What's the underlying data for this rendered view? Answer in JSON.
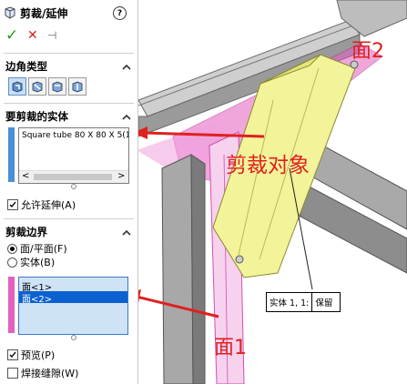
{
  "panel": {
    "title": "剪裁/延伸",
    "help_glyph": "?",
    "confirm_glyph": "✓",
    "cancel_glyph": "✕",
    "pin_glyph": "⊣",
    "corner_type": {
      "label": "边角类型",
      "icons": [
        "end-trim-icon",
        "end-miter-icon",
        "end-butt1-icon",
        "end-butt2-icon"
      ]
    },
    "bodies_to_trim": {
      "label": "要剪裁的实体",
      "items": [
        "Square tube 80 X 80 X 5(1"
      ],
      "scroll_left": "<",
      "scroll_right": ">",
      "allow_extend": {
        "label": "允许延伸(A)",
        "checked": true
      }
    },
    "trim_boundary": {
      "label": "剪裁边界",
      "options": [
        {
          "label": "面/平面(F)",
          "selected": true
        },
        {
          "label": "实体(B)",
          "selected": false
        }
      ],
      "faces": [
        "面<1>",
        "面<2>"
      ],
      "selected_face": "面<2>"
    },
    "preview": {
      "label": "预览(P)",
      "checked": true
    },
    "weld_gap": {
      "label": "焊接缝隙(W)",
      "checked": false
    }
  },
  "viewport": {
    "callout_face2": "面2",
    "callout_face1": "面1",
    "callout_trim_object": "剪裁对象",
    "tag_label": "实体 1, 1:",
    "tag_value": "保留"
  },
  "colors": {
    "accent_blue": "#4a90d9",
    "selection_blue": "#0b61d0",
    "face_pink": "#e45fbf",
    "trim_yellow": "#f3f39a",
    "callout_red": "#e02020"
  }
}
